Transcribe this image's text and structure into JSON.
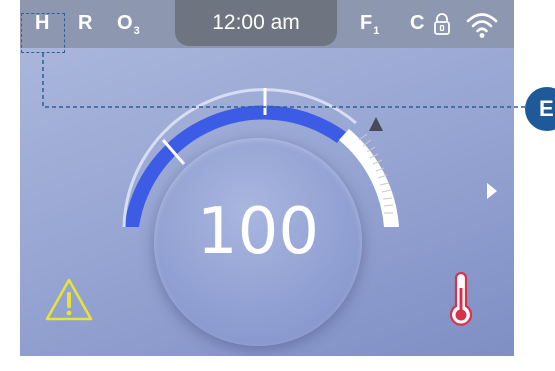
{
  "status_bar": {
    "mode_h": "H",
    "mode_r": "R",
    "mode_o": "O",
    "mode_o_sub": "3",
    "time": "12:00 am",
    "mode_f": "F",
    "mode_f_sub": "1",
    "mode_c": "C",
    "icons": [
      "lock-icon",
      "wifi-icon"
    ]
  },
  "gauge": {
    "value": "100",
    "level_fraction": 0.72
  },
  "bottom": {
    "icons": [
      "warning-icon",
      "thermometer-icon"
    ]
  },
  "callout": {
    "marker_label": "E"
  },
  "colors": {
    "background": "#95a4d2",
    "status_bar": "#8e97b0",
    "time_pill": "#6e7581",
    "gauge_fill": "#3d5ce6",
    "gauge_ticks": "#ffffff",
    "warning": "#e8e23a",
    "thermometer": "#d8314a",
    "callout": "#1e5a99"
  }
}
